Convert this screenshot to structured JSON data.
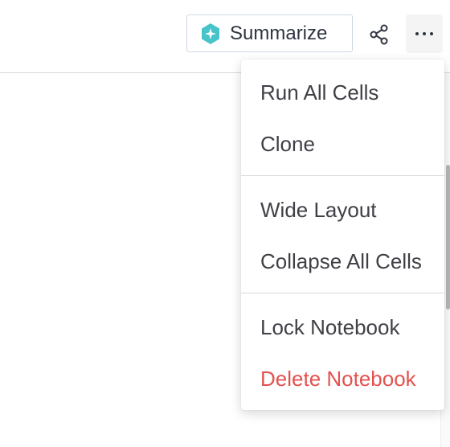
{
  "toolbar": {
    "summarize_label": "Summarize",
    "summarize_icon": "sparkle-icon",
    "share_icon": "share-icon",
    "more_icon": "ellipsis-icon",
    "accent_color": "#46c4c9"
  },
  "menu": {
    "groups": [
      [
        "Run All Cells",
        "Clone"
      ],
      [
        "Wide Layout",
        "Collapse All Cells"
      ],
      [
        "Lock Notebook",
        "Delete Notebook"
      ]
    ],
    "danger_item": "Delete Notebook",
    "danger_color": "#e3524f"
  }
}
